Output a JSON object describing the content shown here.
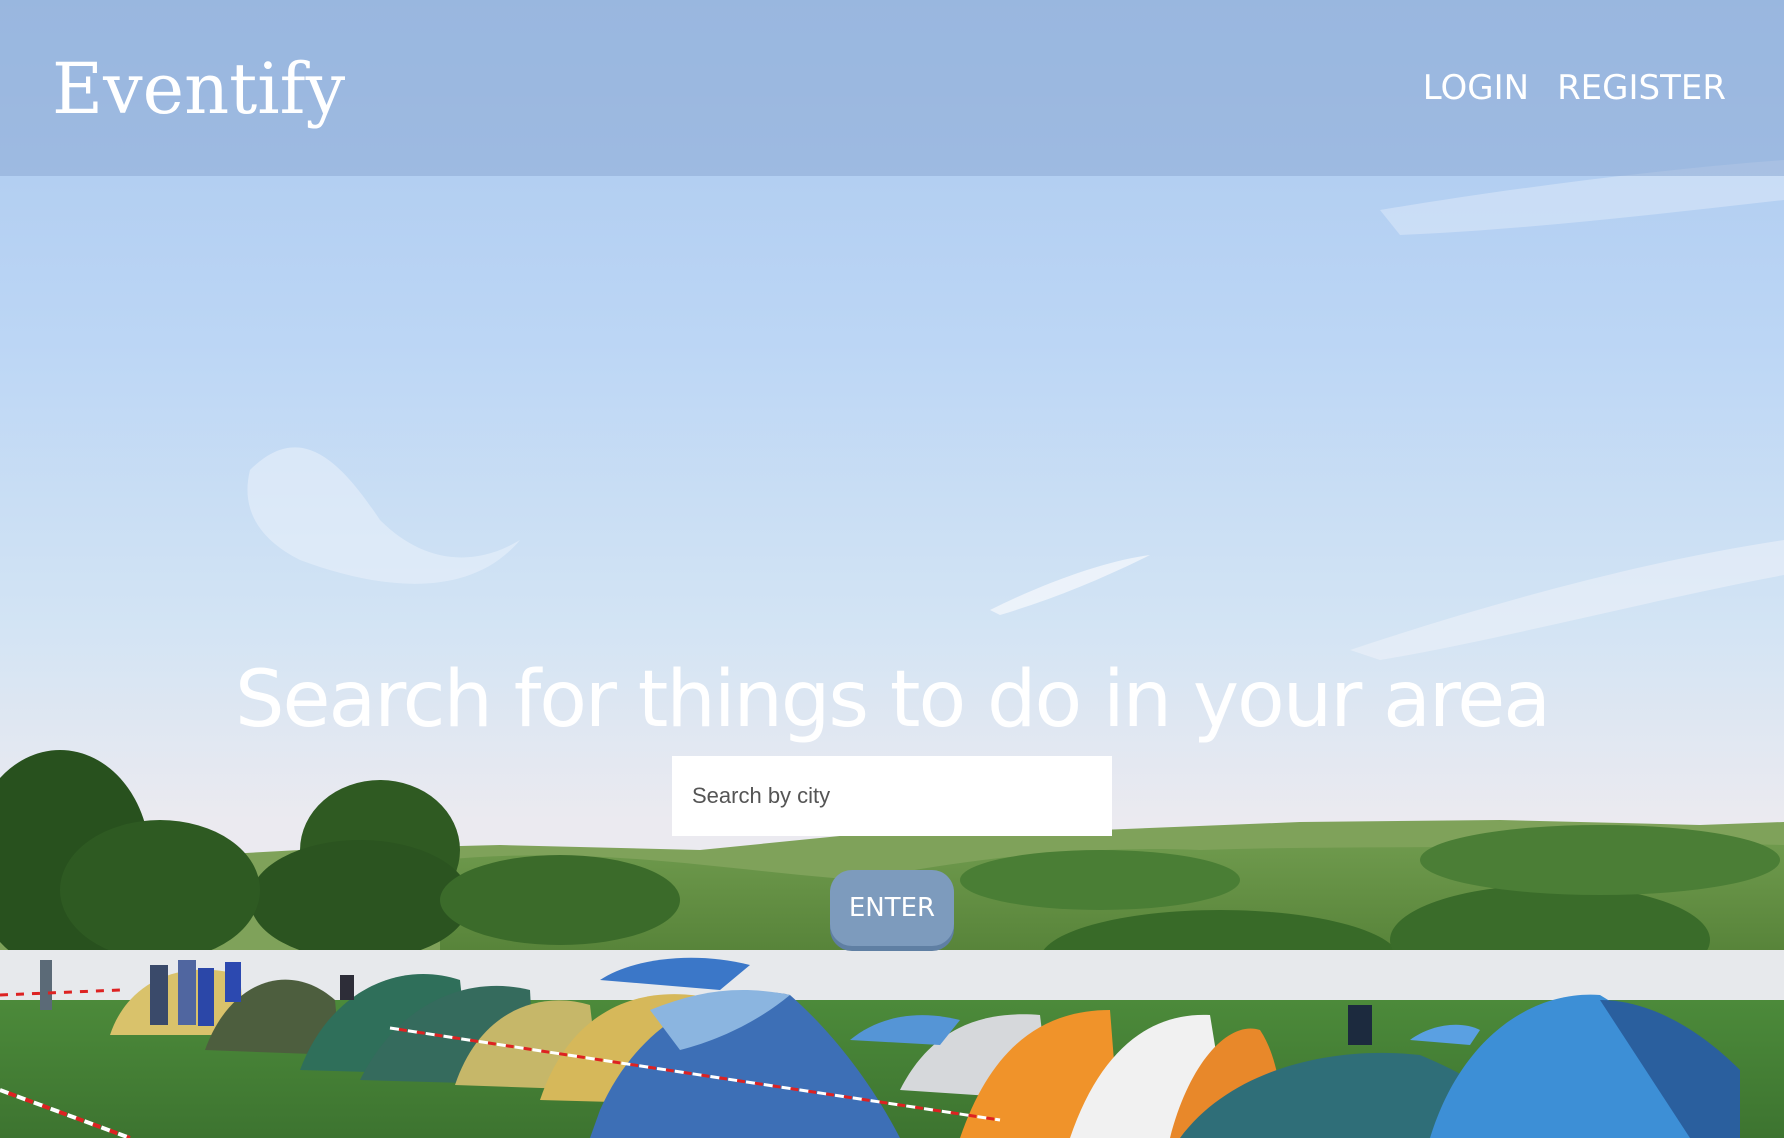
{
  "header": {
    "logo": "Eventify",
    "nav": {
      "login": "LOGIN",
      "register": "REGISTER"
    }
  },
  "hero": {
    "heading": "Search for things to do in your area",
    "search": {
      "placeholder": "Search by city",
      "value": ""
    },
    "enter_label": "ENTER"
  },
  "colors": {
    "header_overlay": "#8caad4",
    "enter_button": "#7d9bbd",
    "text": "#ffffff"
  }
}
